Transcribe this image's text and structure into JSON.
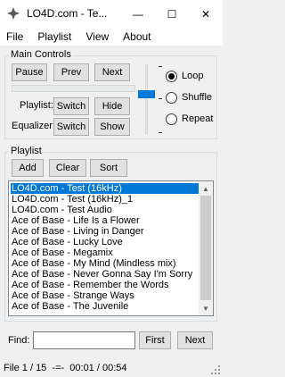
{
  "window": {
    "title": "LO4D.com - Te...",
    "minimize_glyph": "—",
    "maximize_glyph": "☐",
    "close_glyph": "✕"
  },
  "menu": [
    {
      "label": "File"
    },
    {
      "label": "Playlist"
    },
    {
      "label": "View"
    },
    {
      "label": "About"
    }
  ],
  "main_controls": {
    "label": "Main Controls",
    "pause": "Pause",
    "prev": "Prev",
    "next": "Next",
    "playlist_label": "Playlist:",
    "playlist_switch": "Switch",
    "hide": "Hide",
    "equalizer_label": "Equalizer:",
    "equalizer_switch": "Switch",
    "show": "Show",
    "volume_level": 0.42,
    "modes": [
      {
        "label": "Loop",
        "checked": true
      },
      {
        "label": "Shuffle",
        "checked": false
      },
      {
        "label": "Repeat",
        "checked": false
      }
    ]
  },
  "playlist": {
    "label": "Playlist",
    "add": "Add",
    "clear": "Clear",
    "sort": "Sort",
    "items": [
      "LO4D.com - Test (16kHz)",
      "LO4D.com - Test (16kHz)_1",
      "LO4D.com - Test Audio",
      "Ace of Base - Life Is a Flower",
      "Ace of Base - Living in Danger",
      "Ace of Base - Lucky Love",
      "Ace of Base - Megamix",
      "Ace of Base - My Mind (Mindless mix)",
      "Ace of Base - Never Gonna Say I'm Sorry",
      "Ace of Base - Remember the Words",
      "Ace of Base - Strange Ways",
      "Ace of Base - The Juvenile"
    ],
    "selected_index": 0
  },
  "find": {
    "label": "Find:",
    "value": "",
    "first": "First",
    "next": "Next"
  },
  "status": {
    "text": "File 1 / 15  -=-  00:01 / 00:54"
  },
  "colors": {
    "accent": "#0078d7",
    "app_icon": "#5a5a5a"
  }
}
